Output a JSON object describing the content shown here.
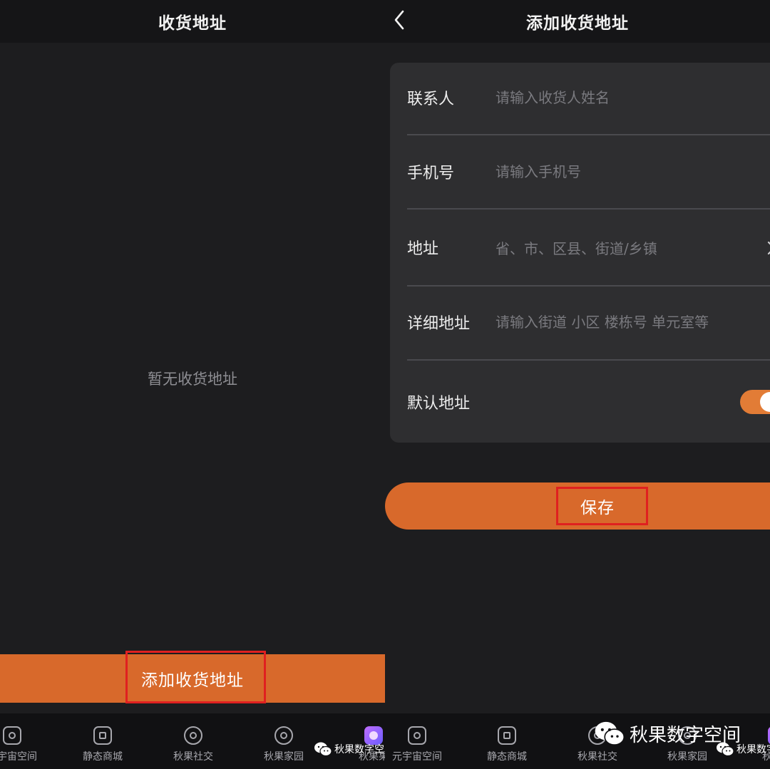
{
  "left_screen": {
    "header_title": "收货地址",
    "empty_text": "暂无收货地址",
    "add_button_label": "添加收货地址"
  },
  "right_screen": {
    "header_title": "添加收货地址",
    "form": {
      "contact_label": "联系人",
      "contact_placeholder": "请输入收货人姓名",
      "phone_label": "手机号",
      "phone_placeholder": "请输入手机号",
      "address_label": "地址",
      "address_placeholder": "省、市、区县、街道/乡镇",
      "detail_label": "详细地址",
      "detail_placeholder": "请输入街道 小区 楼栋号 单元室等",
      "default_label": "默认地址",
      "default_on": true
    },
    "save_button_label": "保存"
  },
  "tabbar_left": [
    {
      "label": "元宇宙空间",
      "icon": "cube-icon"
    },
    {
      "label": "静态商城",
      "icon": "shop-icon"
    },
    {
      "label": "秋果社交",
      "icon": "social-icon"
    },
    {
      "label": "秋果家园",
      "icon": "home-garden-icon"
    },
    {
      "label": "秋果果",
      "icon": "qiuguoguo-icon"
    }
  ],
  "tabbar_right": [
    {
      "label": "元宇宙空间",
      "icon": "cube-icon"
    },
    {
      "label": "静态商城",
      "icon": "shop-icon"
    },
    {
      "label": "秋果社交",
      "icon": "social-icon"
    },
    {
      "label": "秋果家园",
      "icon": "home-garden-icon"
    },
    {
      "label": "秋果果",
      "icon": "qiuguoguo-icon"
    }
  ],
  "watermark": {
    "text": "秋果数字空间",
    "icon": "wechat-icon"
  },
  "colors": {
    "accent": "#d8692b",
    "highlight_box": "#e02020",
    "background": "#1d1d1f",
    "card": "#2e2e30"
  }
}
